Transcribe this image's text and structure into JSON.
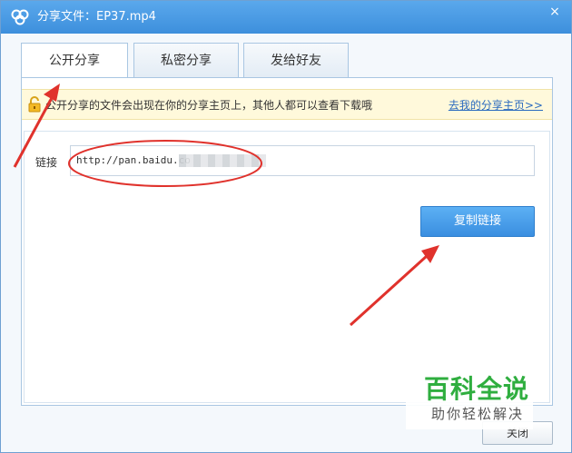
{
  "window": {
    "title": "分享文件：EP37.mp4",
    "close_glyph": "×"
  },
  "tabs": [
    {
      "label": "公开分享",
      "active": true
    },
    {
      "label": "私密分享",
      "active": false
    },
    {
      "label": "发给好友",
      "active": false
    }
  ],
  "notice": {
    "text": "公开分享的文件会出现在你的分享主页上，其他人都可以查看下载哦",
    "link": "去我的分享主页>>"
  },
  "link_field": {
    "label": "链接",
    "value": "http://pan.baidu.co"
  },
  "copy_button": {
    "label": "复制链接"
  },
  "close_button": {
    "label": "关闭"
  },
  "watermark": {
    "title": "百科全说",
    "subtitle": "助你轻松解决"
  },
  "colors": {
    "titlebar": "#3d8fdc",
    "accent": "#3a8ee0",
    "notice_bg": "#fff9db",
    "annotation": "#e0322c",
    "watermark_green": "#2fae3f"
  },
  "icons": [
    "baidu-cloud-logo-icon",
    "close-icon",
    "lock-icon"
  ]
}
